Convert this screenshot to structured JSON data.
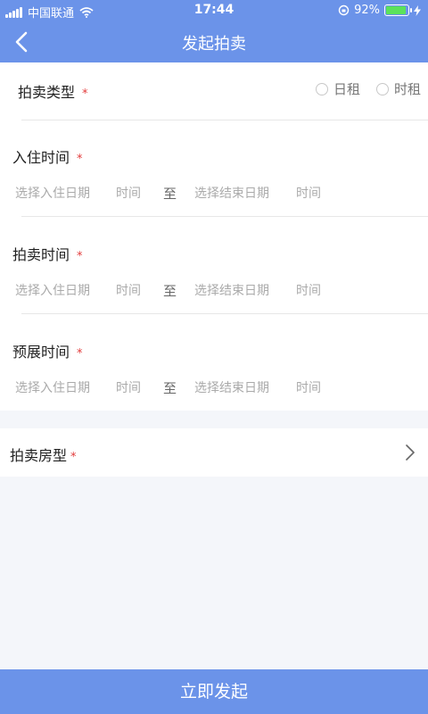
{
  "status_bar": {
    "carrier": "中国联通",
    "time": "17:44",
    "battery": "92%",
    "battery_level": 0.92
  },
  "nav": {
    "title": "发起拍卖"
  },
  "form": {
    "auction_type": {
      "label": "拍卖类型",
      "required_mark": "*",
      "options": [
        "日租",
        "时租"
      ]
    },
    "checkin_time": {
      "label": "入住时间",
      "required_mark": "*",
      "start_date_placeholder": "选择入住日期",
      "start_time_placeholder": "时间",
      "separator": "至",
      "end_date_placeholder": "选择结束日期",
      "end_time_placeholder": "时间"
    },
    "auction_time": {
      "label": "拍卖时间",
      "required_mark": "*",
      "start_date_placeholder": "选择入住日期",
      "start_time_placeholder": "时间",
      "separator": "至",
      "end_date_placeholder": "选择结束日期",
      "end_time_placeholder": "时间"
    },
    "preview_time": {
      "label": "预展时间",
      "required_mark": "*",
      "start_date_placeholder": "选择入住日期",
      "start_time_placeholder": "时间",
      "separator": "至",
      "end_date_placeholder": "选择结束日期",
      "end_time_placeholder": "时间"
    },
    "room_type": {
      "label": "拍卖房型",
      "required_mark": "*"
    }
  },
  "submit_label": "立即发起",
  "colors": {
    "primary": "#6b93e9",
    "required": "#e23b3b",
    "placeholder": "#aaaaaa",
    "background": "#f4f6fa"
  }
}
